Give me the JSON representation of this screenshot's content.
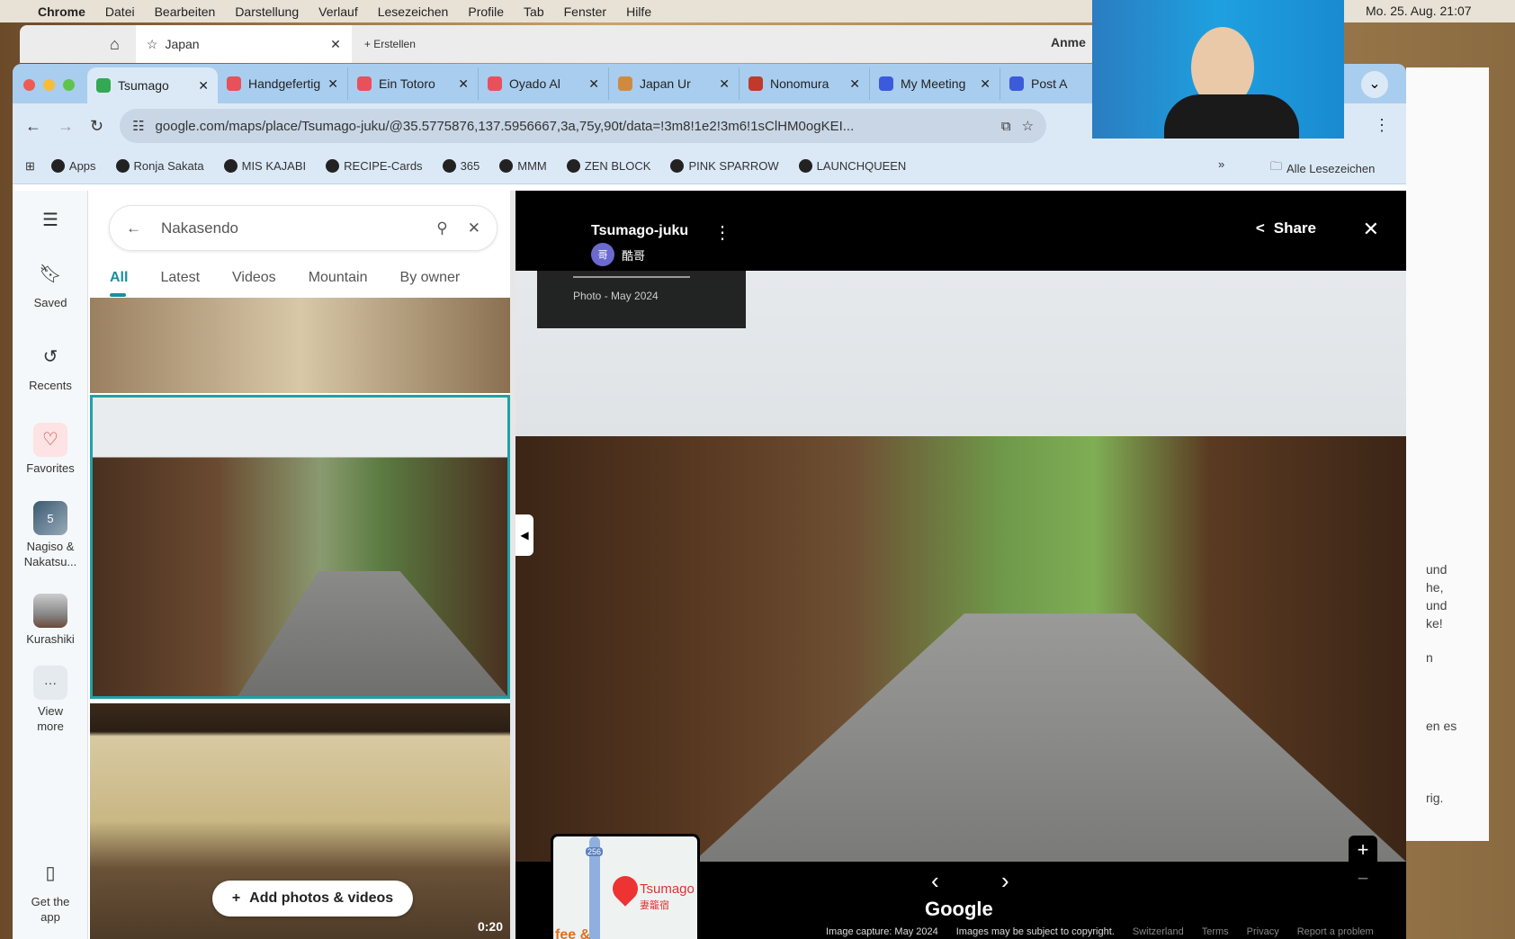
{
  "menubar": {
    "items": [
      "Chrome",
      "Datei",
      "Bearbeiten",
      "Darstellung",
      "Verlauf",
      "Lesezeichen",
      "Profile",
      "Tab",
      "Fenster",
      "Hilfe"
    ],
    "clock": "Mo. 25. Aug. 21:07"
  },
  "back_window": {
    "tab": "Japan",
    "new_button": "Erstellen",
    "profile": "Anme"
  },
  "tabs": [
    {
      "label": "Tsumago",
      "color": "#34a853"
    },
    {
      "label": "Handgefertigt",
      "color": "#e8505b"
    },
    {
      "label": "Ein Totoro",
      "color": "#e8505b"
    },
    {
      "label": "Oyado Al",
      "color": "#e8505b"
    },
    {
      "label": "Japan Ur",
      "color": "#d08a40"
    },
    {
      "label": "Nonomura",
      "color": "#c0392b"
    },
    {
      "label": "My Meeting",
      "color": "#3b5bdb"
    },
    {
      "label": "Post A",
      "color": "#3b5bdb"
    }
  ],
  "address": {
    "url": "google.com/maps/place/Tsumago-juku/@35.5775876,137.5956667,3a,75y,90t/data=!3m8!1e2!3m6!1sClHM0ogKEI..."
  },
  "bookmarks": [
    "Apps",
    "Ronja Sakata",
    "MIS KAJABI",
    "RECIPE-Cards",
    "365",
    "MMM",
    "ZEN BLOCK",
    "PINK SPARROW",
    "LAUNCHQUEEN"
  ],
  "all_bookmarks": "Alle Lesezeichen",
  "rail": {
    "saved": "Saved",
    "recents": "Recents",
    "favorites": "Favorites",
    "list1": "Nagiso & Nakatsu...",
    "list1_count": "5",
    "list2": "Kurashiki",
    "view_more": "View more",
    "get_app": "Get the app"
  },
  "search": {
    "query": "Nakasendo"
  },
  "photo_tabs": [
    "All",
    "Latest",
    "Videos",
    "Mountain",
    "By owner"
  ],
  "add_photos": "Add photos & videos",
  "video_duration": "0:20",
  "viewer": {
    "title": "Tsumago-juku",
    "user": "酷哥",
    "user_initial": "哥",
    "date": "Photo - May 2024",
    "share": "Share",
    "map_label": "Tsumago",
    "map_label_jp": "妻籠宿",
    "map_route": "256",
    "map_cafe": "fee & offee)",
    "logo": "Google",
    "footer": [
      "Image capture: May 2024",
      "Images may be subject to copyright.",
      "Switzerland",
      "Terms",
      "Privacy",
      "Report a problem"
    ]
  },
  "right_window_text": [
    "und",
    "he,",
    "und",
    "ke!",
    "n",
    "en es",
    "rig."
  ]
}
